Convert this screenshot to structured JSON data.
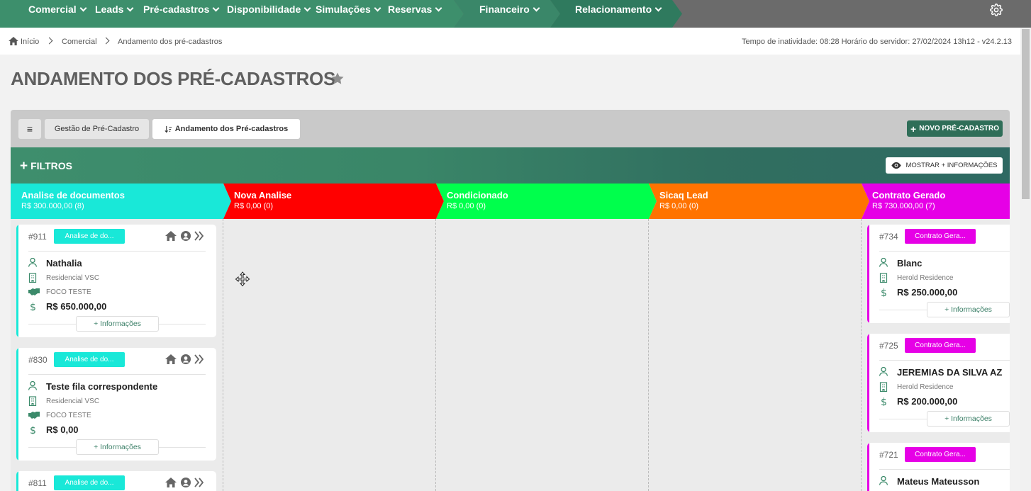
{
  "nav": {
    "items": [
      "Comercial",
      "Leads",
      "Pré-cadastros",
      "Disponibilidade",
      "Simulações",
      "Reservas",
      "Financeiro",
      "Relacionamento"
    ]
  },
  "breadcrumb": {
    "home": "Início",
    "level1": "Comercial",
    "current": "Andamento dos pré-cadastros",
    "server": "Tempo de inatividade: 08:28  Horário do servidor: 27/02/2024 13h12 - v24.2.13"
  },
  "page": {
    "title": "ANDAMENTO DOS PRÉ-CADASTROS"
  },
  "toolbar": {
    "menu": "≡",
    "tab1": "Gestão de Pré-Cadastro",
    "tab2": "Andamento dos Pré-cadastros",
    "new_btn": "NOVO PRÉ-CADASTRO"
  },
  "filters": {
    "label": "FILTROS",
    "more": "MOSTRAR + INFORMAÇÕES"
  },
  "columns": [
    {
      "name": "Analise de documentos",
      "sum": "R$ 300.000,00 (8)",
      "color": "#19e8d8"
    },
    {
      "name": "Nova Analise",
      "sum": "R$ 0,00 (0)",
      "color": "#ff0000"
    },
    {
      "name": "Condicionado",
      "sum": "R$ 0,00 (0)",
      "color": "#00ff4c"
    },
    {
      "name": "Sicaq Lead",
      "sum": "R$ 0,00 (0)",
      "color": "#ff7300"
    },
    {
      "name": "Contrato Gerado",
      "sum": "R$ 730.000,00 (7)",
      "color": "#e600e6"
    }
  ],
  "cards_col1": [
    {
      "num": "#911",
      "badge": "Analise de do...",
      "name": "Nathalia",
      "project": "Residencial VSC",
      "team": "FOCO TESTE",
      "value": "R$ 650.000,00",
      "info": "+ Informações"
    },
    {
      "num": "#830",
      "badge": "Analise de do...",
      "name": "Teste fila correspondente",
      "project": "Residencial VSC",
      "team": "FOCO TESTE",
      "value": "R$ 0,00",
      "info": "+ Informações"
    },
    {
      "num": "#811",
      "badge": "Analise de do..."
    }
  ],
  "cards_col5": [
    {
      "num": "#734",
      "badge": "Contrato Gera...",
      "name": "Blanc",
      "project": "Herold Residence",
      "value": "R$ 250.000,00",
      "info": "+ Informações"
    },
    {
      "num": "#725",
      "badge": "Contrato Gera...",
      "name": "JEREMIAS DA SILVA AZ",
      "project": "Herold Residence",
      "value": "R$ 200.000,00",
      "info": "+ Informações"
    },
    {
      "num": "#721",
      "badge": "Contrato Gera...",
      "name": "Mateus Mateusson"
    }
  ],
  "colors": {
    "accent": "#3d8f6c",
    "dark_accent": "#2f6e58",
    "icon_green": "#3b8a6a"
  }
}
